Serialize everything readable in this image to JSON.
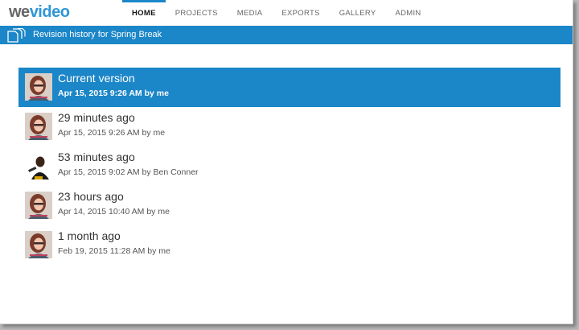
{
  "app": {
    "logo_we": "we",
    "logo_video": "video"
  },
  "nav": {
    "items": [
      {
        "label": "HOME",
        "active": true
      },
      {
        "label": "PROJECTS",
        "active": false
      },
      {
        "label": "MEDIA",
        "active": false
      },
      {
        "label": "EXPORTS",
        "active": false
      },
      {
        "label": "GALLERY",
        "active": false
      },
      {
        "label": "ADMIN",
        "active": false
      }
    ]
  },
  "titlebar": {
    "icon": "documents-icon",
    "title": "Revision history for Spring Break"
  },
  "revisions": [
    {
      "when": "Current version",
      "detail": "Apr 15, 2015 9:26 AM by me",
      "selected": true,
      "avatar": "woman-avatar"
    },
    {
      "when": "29 minutes ago",
      "detail": "Apr 15, 2015 9:26 AM by me",
      "selected": false,
      "avatar": "woman-avatar"
    },
    {
      "when": "53 minutes ago",
      "detail": "Apr 15, 2015 9:02 AM by Ben Conner",
      "selected": false,
      "avatar": "man-avatar"
    },
    {
      "when": "23 hours ago",
      "detail": "Apr 14, 2015 10:40 AM by me",
      "selected": false,
      "avatar": "woman-avatar"
    },
    {
      "when": "1 month ago",
      "detail": "Feb 19, 2015 11:28 AM by me",
      "selected": false,
      "avatar": "woman-avatar"
    }
  ],
  "colors": {
    "accent": "#1b86c8",
    "logo_blue": "#2f96d6"
  }
}
